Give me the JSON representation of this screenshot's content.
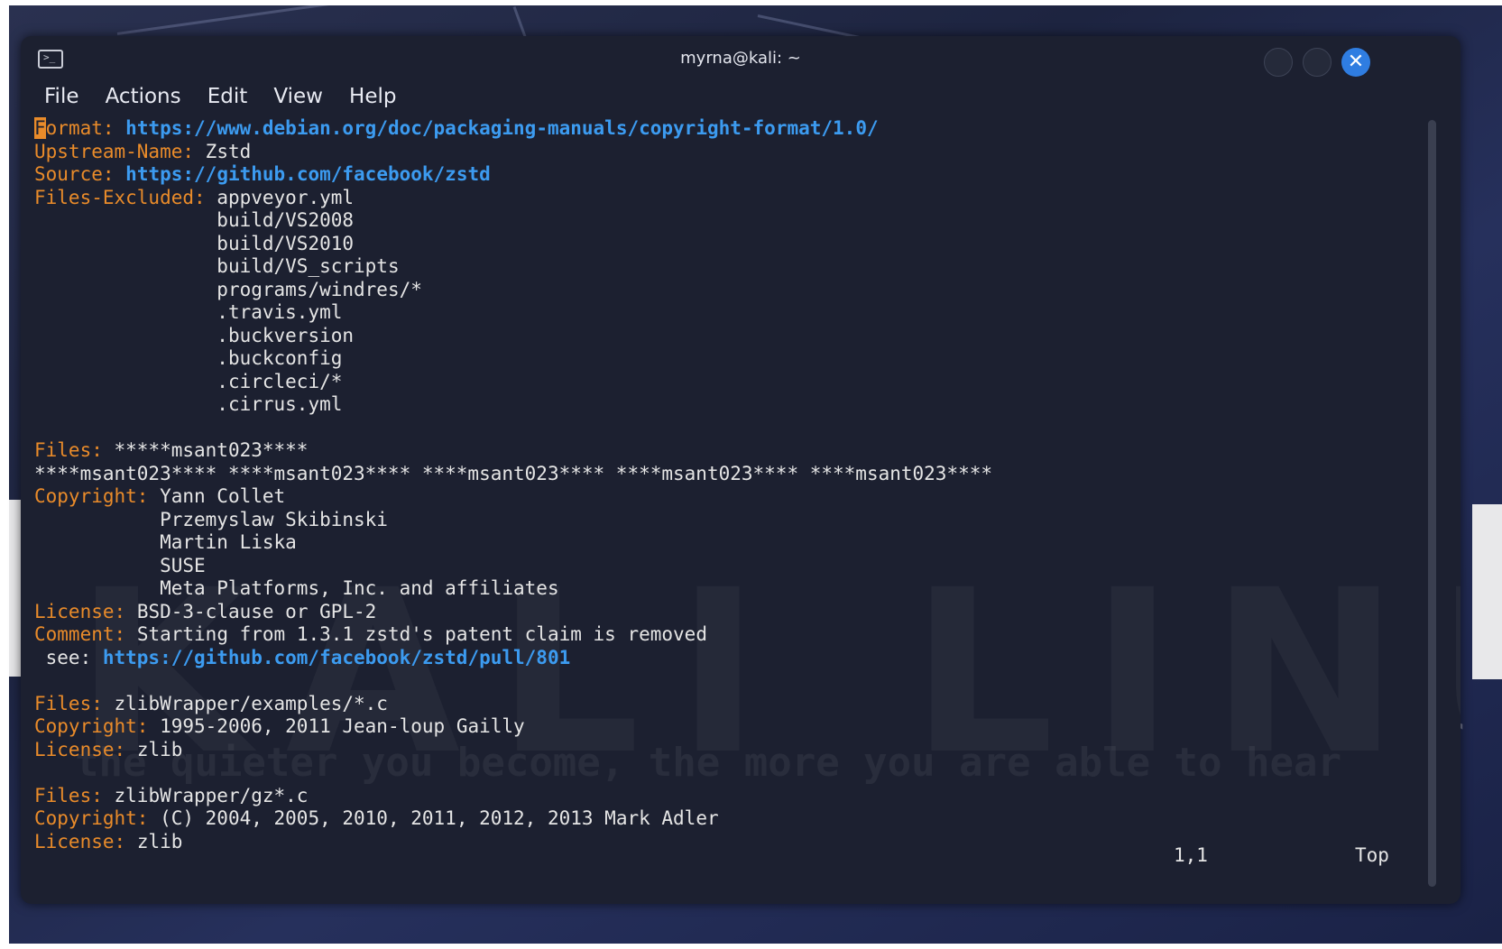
{
  "window": {
    "title": "myrna@kali: ~",
    "terminal_icon": "terminal-icon"
  },
  "menu": [
    "File",
    "Actions",
    "Edit",
    "View",
    "Help"
  ],
  "watermark": "KALI LINUX",
  "tagline": "the quieter you become, the more you are able to hear",
  "lines": [
    {
      "key": "Format:",
      "url": "https://www.debian.org/doc/packaging-manuals/copyright-format/1.0/",
      "cursor": true
    },
    {
      "key": "Upstream-Name:",
      "text": "Zstd"
    },
    {
      "key": "Source:",
      "url": "https://github.com/facebook/zstd"
    },
    {
      "key": "Files-Excluded:",
      "text": "appveyor.yml"
    },
    {
      "indent": "                ",
      "text": "build/VS2008"
    },
    {
      "indent": "                ",
      "text": "build/VS2010"
    },
    {
      "indent": "                ",
      "text": "build/VS_scripts"
    },
    {
      "indent": "                ",
      "text": "programs/windres/*"
    },
    {
      "indent": "                ",
      "text": ".travis.yml"
    },
    {
      "indent": "                ",
      "text": ".buckversion"
    },
    {
      "indent": "                ",
      "text": ".buckconfig"
    },
    {
      "indent": "                ",
      "text": ".circleci/*"
    },
    {
      "indent": "                ",
      "text": ".cirrus.yml"
    },
    {
      "text": ""
    },
    {
      "key": "Files:",
      "text": "*****msant023****"
    },
    {
      "text": "****msant023**** ****msant023**** ****msant023**** ****msant023**** ****msant023****"
    },
    {
      "key": "Copyright:",
      "text": "Yann Collet"
    },
    {
      "indent": "           ",
      "text": "Przemyslaw Skibinski"
    },
    {
      "indent": "           ",
      "text": "Martin Liska"
    },
    {
      "indent": "           ",
      "text": "SUSE"
    },
    {
      "indent": "           ",
      "text": "Meta Platforms, Inc. and affiliates"
    },
    {
      "key": "License:",
      "text": "BSD-3-clause or GPL-2"
    },
    {
      "key": "Comment:",
      "text": "Starting from 1.3.1 zstd's patent claim is removed"
    },
    {
      "text": " see: ",
      "url": "https://github.com/facebook/zstd/pull/801"
    },
    {
      "text": ""
    },
    {
      "key": "Files:",
      "text": "zlibWrapper/examples/*.c"
    },
    {
      "key": "Copyright:",
      "text": "1995-2006, 2011 Jean-loup Gailly"
    },
    {
      "key": "License:",
      "text": "zlib"
    },
    {
      "text": ""
    },
    {
      "key": "Files:",
      "text": "zlibWrapper/gz*.c"
    },
    {
      "key": "Copyright:",
      "text": "(C) 2004, 2005, 2010, 2011, 2012, 2013 Mark Adler"
    },
    {
      "key": "License:",
      "text": "zlib"
    }
  ],
  "status": {
    "position": "1,1",
    "scroll": "Top"
  },
  "colors": {
    "key": "#e98b2a",
    "url": "#3c9bf0",
    "close_button": "#2f7de1"
  }
}
